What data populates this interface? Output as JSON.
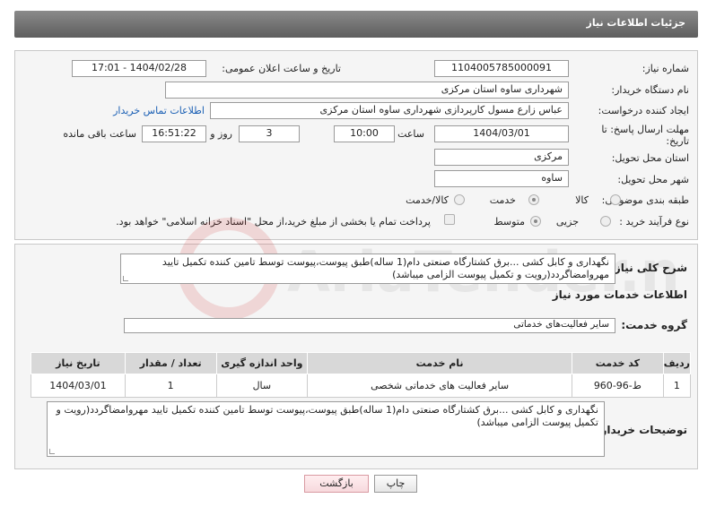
{
  "header": {
    "title": "جزئیات اطلاعات نیاز"
  },
  "form": {
    "need_number": {
      "label": "شماره نیاز:",
      "value": "1104005785000091"
    },
    "announce_datetime": {
      "label": "تاریخ و ساعت اعلان عمومی:",
      "value": "1404/02/28 - 17:01"
    },
    "buyer_org": {
      "label": "نام دستگاه خریدار:",
      "value": "شهرداری ساوه استان مرکزی"
    },
    "requester": {
      "label": "ایجاد کننده درخواست:",
      "value": "عباس زارع مسول کارپردازی شهرداری ساوه استان مرکزی"
    },
    "buyer_contact_link": "اطلاعات تماس خریدار",
    "deadline": {
      "label_line1": "مهلت ارسال پاسخ: تا",
      "label_line2": "تاریخ:",
      "date": "1404/03/01",
      "time_label": "ساعت",
      "time": "10:00",
      "days": "3",
      "days_label": "روز و",
      "remaining": "16:51:22",
      "remaining_label": "ساعت باقی مانده"
    },
    "province": {
      "label": "استان محل تحویل:",
      "value": "مرکزی"
    },
    "city": {
      "label": "شهر محل تحویل:",
      "value": "ساوه"
    },
    "category": {
      "label": "طبقه بندی موضوعی:",
      "options": [
        "کالا",
        "خدمت",
        "کالا/خدمت"
      ],
      "selected": "خدمت"
    },
    "process": {
      "label": "نوع فرآیند خرید :",
      "options": [
        "جزیی",
        "متوسط"
      ],
      "selected": "متوسط",
      "payment_note": "پرداخت تمام یا بخشی از مبلغ خرید،از محل \"اسناد خزانه اسلامی\" خواهد بود."
    }
  },
  "summary": {
    "label": "شرح کلی نیاز:",
    "text": "نگهداری و کابل کشی ...برق کشتارگاه صنعتی دام(1 ساله)طبق پیوست،پیوست توسط تامین کننده تکمیل تایید مهروامضاگردد(رویت و تکمیل پیوست الزامی میباشد)"
  },
  "services": {
    "section_title": "اطلاعات خدمات مورد نیاز",
    "group_label": "گروه خدمت:",
    "group_value": "سایر فعالیت‌های خدماتی",
    "columns": [
      "ردیف",
      "کد خدمت",
      "نام خدمت",
      "واحد اندازه گیری",
      "تعداد / مقدار",
      "تاریخ نیاز"
    ],
    "rows": [
      [
        "1",
        "ط-96-960",
        "سایر فعالیت های خدماتی شخصی",
        "سال",
        "1",
        "1404/03/01"
      ]
    ]
  },
  "buyer_notes": {
    "label": "توضیحات خریدار:",
    "text": "نگهداری و کابل کشی ...برق کشتارگاه صنعتی دام(1 ساله)طبق پیوست،پیوست توسط تامین کننده تکمیل تایید مهروامضاگردد(رویت و تکمیل پیوست الزامی میباشد)"
  },
  "buttons": {
    "print": "چاپ",
    "back": "بازگشت"
  },
  "watermark": "AriaTender.net"
}
